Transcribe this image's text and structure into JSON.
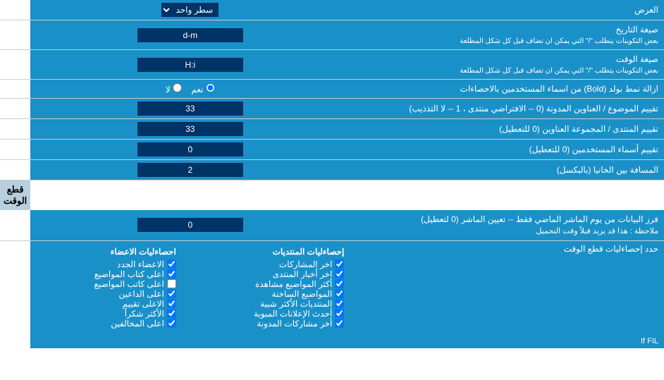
{
  "page": {
    "title": "العرض",
    "rows": [
      {
        "id": "display_mode",
        "label": "العرض",
        "input_type": "dropdown",
        "value": "سطر واحد"
      },
      {
        "id": "date_format",
        "label": "صيغة التاريخ",
        "sublabel": "بعض التكوينات يتطلب \"/\" التي يمكن ان تضاف قبل كل شكل المطلعة",
        "input_type": "text",
        "value": "d-m"
      },
      {
        "id": "time_format",
        "label": "صيغة الوقت",
        "sublabel": "بعض التكوينات يتطلب \"/\" التي يمكن ان تضاف قبل كل شكل المطلعة",
        "input_type": "text",
        "value": "H:i"
      },
      {
        "id": "bold_remove",
        "label": "ازالة نمط بولد (Bold) من اسماء المستخدمين بالاحصاءات",
        "input_type": "radio",
        "options": [
          "نعم",
          "لا"
        ],
        "selected": "نعم"
      },
      {
        "id": "topic_titles",
        "label": "تقييم الموضوع / العناوين المدونة (0 -- الافتراضي منتدى ، 1 -- لا التذذيب)",
        "input_type": "text",
        "value": "33"
      },
      {
        "id": "forum_titles",
        "label": "تقييم المنتدى / المجموعة العناوين (0 للتعطيل)",
        "input_type": "text",
        "value": "33"
      },
      {
        "id": "usernames_length",
        "label": "تقييم أسماء المستخدمين (0 للتعطيل)",
        "input_type": "text",
        "value": "0"
      },
      {
        "id": "column_gap",
        "label": "المسافة بين الخانيا (بالبكسل)",
        "input_type": "text",
        "value": "2"
      }
    ],
    "snapshot_section": {
      "header": "قطع الوقت",
      "rows": [
        {
          "id": "snapshot_days",
          "label": "فرز البيانات من يوم الماشر الماضي فقط -- تعيين الماشر (0 لتعطيل)",
          "note": "ملاحظة : هذا قد يزيد قبلاً وقت التحميل",
          "input_type": "text",
          "value": "0"
        }
      ],
      "stats_label": "حدد إحصاءليات قطع الوقت",
      "checkboxes_col1": [
        {
          "id": "cb_posts",
          "label": "إحصاءليات المنتديات",
          "checked": true
        },
        {
          "id": "cb_shares",
          "label": "اخر المشاركات",
          "checked": true
        },
        {
          "id": "cb_news",
          "label": "اخر أخبار المنتدى",
          "checked": true
        },
        {
          "id": "cb_views",
          "label": "أكثر المواضيع مشاهدة",
          "checked": true
        },
        {
          "id": "cb_old",
          "label": "المواضيع الساخنة",
          "checked": true
        },
        {
          "id": "cb_similar",
          "label": "المنتديات الأكثر شبية",
          "checked": true
        },
        {
          "id": "cb_ads",
          "label": "أحدث الإعلانات المبوبة",
          "checked": true
        },
        {
          "id": "cb_last_posts",
          "label": "أخر مشاركات المدونة",
          "checked": true
        }
      ],
      "checkboxes_col2": [
        {
          "id": "cb_members",
          "label": "احصاءليات الاعضاء",
          "checked": true
        },
        {
          "id": "cb_new",
          "label": "الاعضاء الجدد",
          "checked": true
        },
        {
          "id": "cb_top_posters",
          "label": "اعلى كتاب المواضيع",
          "checked": true
        },
        {
          "id": "cb_posters",
          "label": "اعلى كاتب المواضيع",
          "checked": false
        },
        {
          "id": "cb_referrers",
          "label": "اعلى الداعين",
          "checked": true
        },
        {
          "id": "cb_rated",
          "label": "الاعلى تقييم",
          "checked": true
        },
        {
          "id": "cb_thanks",
          "label": "الأكثر شكراً",
          "checked": true
        },
        {
          "id": "cb_ignored",
          "label": "اعلى المخالفين",
          "checked": true
        }
      ]
    }
  }
}
